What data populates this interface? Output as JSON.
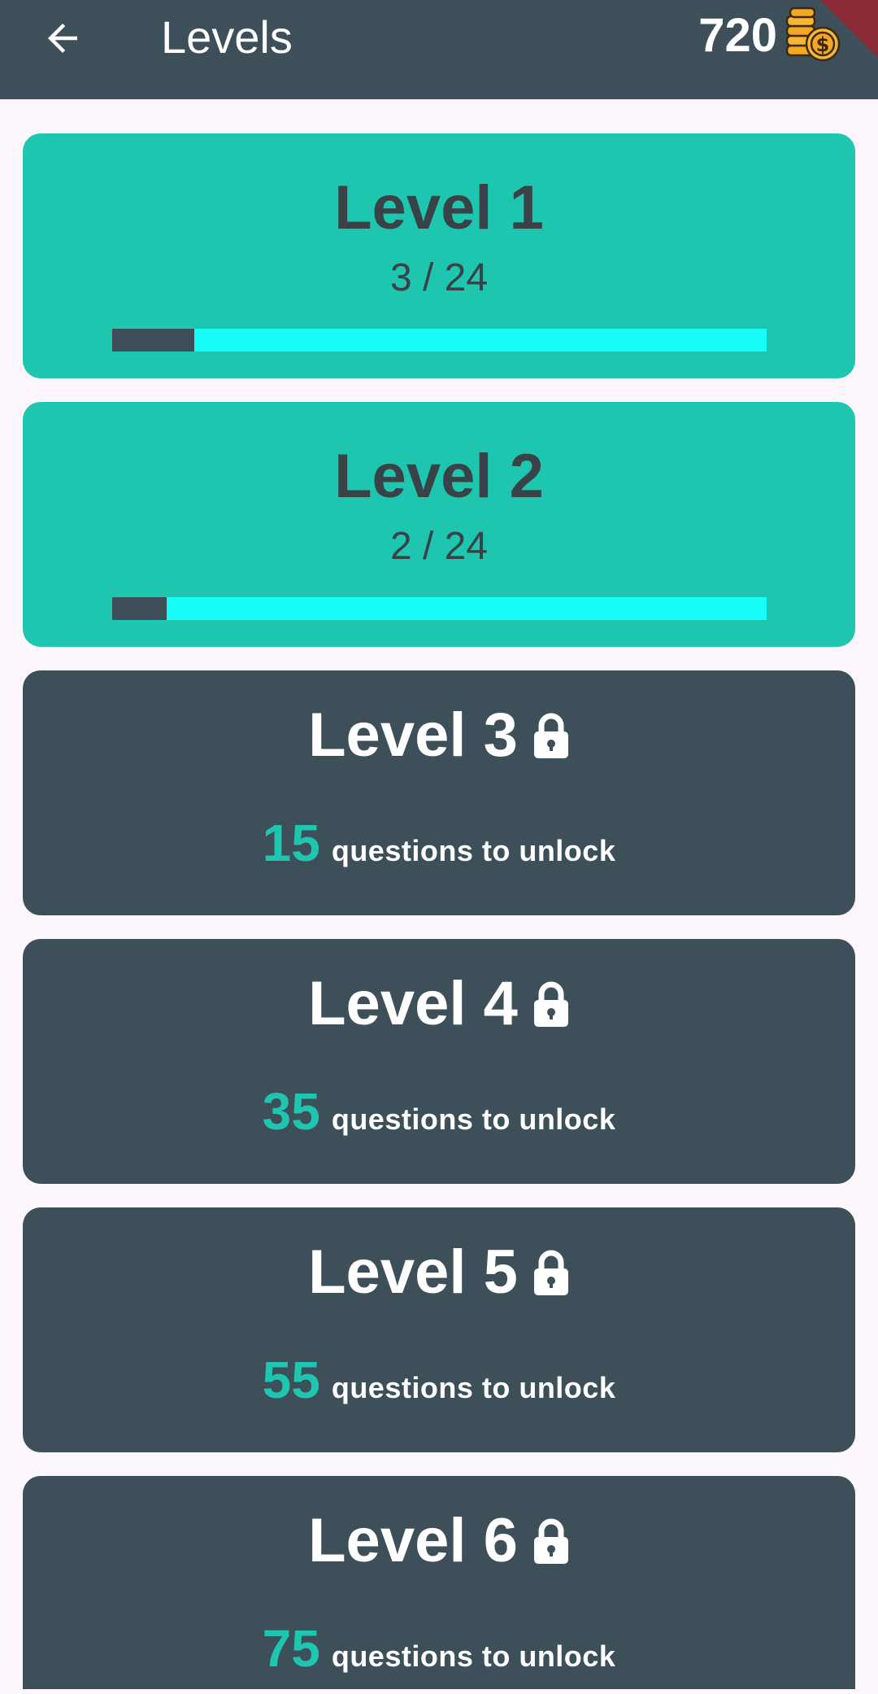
{
  "appbar": {
    "title": "Levels",
    "coins": "720",
    "back_icon": "arrow-left-icon",
    "coins_icon": "coin-stack-icon"
  },
  "colors": {
    "appbar": "#3d4f59",
    "unlocked_card": "#1fc6af",
    "locked_card": "#3d4f59",
    "progress_track": "#18fdfa",
    "progress_fill": "#3d4f59",
    "accent": "#1fc6af",
    "background": "#fdf7fd"
  },
  "levels": [
    {
      "title": "Level 1",
      "progress_label": "3 / 24",
      "progress": 0.125,
      "locked": false
    },
    {
      "title": "Level 2",
      "progress_label": "2 / 24",
      "progress": 0.0833,
      "locked": false
    },
    {
      "title": "Level 3",
      "unlock_count": "15",
      "unlock_text": "questions to unlock",
      "locked": true,
      "icon": "lock-icon"
    },
    {
      "title": "Level 4",
      "unlock_count": "35",
      "unlock_text": "questions to unlock",
      "locked": true,
      "icon": "lock-icon"
    },
    {
      "title": "Level 5",
      "unlock_count": "55",
      "unlock_text": "questions to unlock",
      "locked": true,
      "icon": "lock-icon"
    },
    {
      "title": "Level 6",
      "unlock_count": "75",
      "unlock_text": "questions to unlock",
      "locked": true,
      "icon": "lock-icon"
    }
  ]
}
